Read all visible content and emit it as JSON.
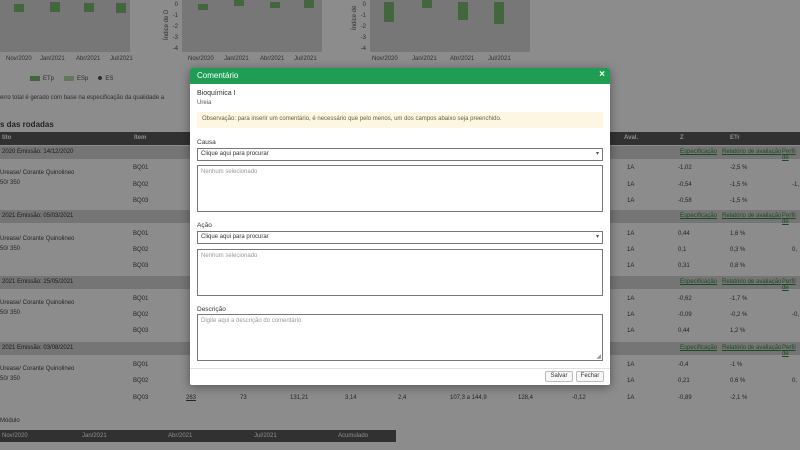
{
  "charts": [
    {
      "x_ticks": [
        "Nov/2020",
        "Jan/2021",
        "Abr/2021",
        "Jul/2021"
      ],
      "y_ticks": [],
      "y_title": ""
    },
    {
      "x_ticks": [
        "Nov/2020",
        "Jan/2021",
        "Abr/2021",
        "Jul/2021"
      ],
      "y_ticks": [
        "0",
        "-1",
        "-2",
        "-3",
        "-4"
      ],
      "y_title": "Índice de D"
    },
    {
      "x_ticks": [
        "Nov/2020",
        "Jan/2021",
        "Abr/2021",
        "Jul/2021"
      ],
      "y_ticks": [
        "0",
        "-1",
        "-2",
        "-3",
        "-4"
      ],
      "y_title": "Índice de"
    }
  ],
  "legend": [
    {
      "label": "ETp",
      "color": "#7dbb74"
    },
    {
      "label": "ESp",
      "color": "#b5d9a8"
    },
    {
      "label": "ES",
      "color": "#555555"
    }
  ],
  "note": "erro total é gerado com base na especificação da qualidade a",
  "section_title": "s das rodadas",
  "table_headers": {
    "c1": "tito",
    "c2": "Item",
    "c3": "Aval.",
    "c4": "Z",
    "c5": "ETr"
  },
  "groups": [
    {
      "header": "2020   Emissão: 14/12/2020",
      "desc1": "Urease/ Corante Quinolineo",
      "desc2": "50/ 350",
      "links": [
        "Especificação",
        "Relatório de avaliação",
        "Perfil de"
      ],
      "rows": [
        {
          "item": "BQ01",
          "aval": "1A",
          "z": "-1,02",
          "etr": "-2,5 %"
        },
        {
          "item": "BQ02",
          "aval": "1A",
          "z": "-0,54",
          "etr": "-1,5 %",
          "extra": "-1,"
        },
        {
          "item": "BQ03",
          "aval": "1A",
          "z": "-0,58",
          "etr": "-1,5 %"
        }
      ]
    },
    {
      "header": "2021   Emissão: 05/03/2021",
      "desc1": "Urease/ Corante Quinolineo",
      "desc2": "50/ 350",
      "links": [
        "Especificação",
        "Relatório de avaliação",
        "Perfil de"
      ],
      "rows": [
        {
          "item": "BQ01",
          "aval": "1A",
          "z": "0,44",
          "etr": "1,6 %"
        },
        {
          "item": "BQ02",
          "aval": "1A",
          "z": "0,1",
          "etr": "0,3 %",
          "extra": "0,"
        },
        {
          "item": "BQ03",
          "aval": "1A",
          "z": "0,31",
          "etr": "0,8 %"
        }
      ]
    },
    {
      "header": "2021   Emissão: 25/05/2021",
      "desc1": "Urease/ Corante Quinolineo",
      "desc2": "50/ 350",
      "links": [
        "Especificação",
        "Relatório de avaliação",
        "Perfil de"
      ],
      "rows": [
        {
          "item": "BQ01",
          "aval": "1A",
          "z": "-0,62",
          "etr": "-1,7 %"
        },
        {
          "item": "BQ02",
          "aval": "1A",
          "z": "-0,09",
          "etr": "-0,2 %",
          "extra": "-0,"
        },
        {
          "item": "BQ03",
          "aval": "1A",
          "z": "0,44",
          "etr": "1,2 %"
        }
      ]
    },
    {
      "header": "2021   Emissão: 03/08/2021",
      "desc1": "Urease/ Corante Quinolineo",
      "desc2": "50/ 350",
      "links": [
        "Especificação",
        "Relatório de avaliação",
        "Perfil de"
      ],
      "rows": [
        {
          "item": "BQ01",
          "aval": "1A",
          "z": "-0,4",
          "etr": "-1 %"
        },
        {
          "item": "BQ02",
          "aval": "1A",
          "z": "0,21",
          "etr": "0,6 %",
          "extra": "0,"
        },
        {
          "item": "BQ03",
          "aval": "1A",
          "z": "-0,89",
          "etr": "-2,1 %",
          "c1": "263",
          "c2": "73",
          "c3": "131,21",
          "c4": "3,14",
          "c5": "2,4",
          "c6": "107,3 a 144,9",
          "c7": "128,4",
          "c8": "-0,12"
        }
      ]
    }
  ],
  "footer": {
    "title": "Módulo",
    "headers": [
      "Nov/2020",
      "Jan/2021",
      "Abr/2021",
      "Jul/2021",
      "Acumulado"
    ]
  },
  "modal": {
    "title": "Comentário",
    "close": "×",
    "subtitle": "Bioquímica I",
    "analyte": "Ureia",
    "observation": "Observação: para inserir um comentário, é necessário que pelo menos, um dos campos abaixo seja preenchido.",
    "causa_label": "Causa",
    "causa_select": "Clique aqui para procurar",
    "causa_list_placeholder": "Nenhum selecionado",
    "acao_label": "Ação",
    "acao_select": "Clique aqui para procurar",
    "acao_list_placeholder": "Nenhum selecionado",
    "descricao_label": "Descrição",
    "descricao_placeholder": "Digite aqui a descrição do comentário",
    "save": "Salvar",
    "close_button": "Fechar"
  },
  "colors": {
    "accent": "#1f9d55",
    "table_header": "#5a5a5a",
    "link": "#2e8b3e"
  }
}
